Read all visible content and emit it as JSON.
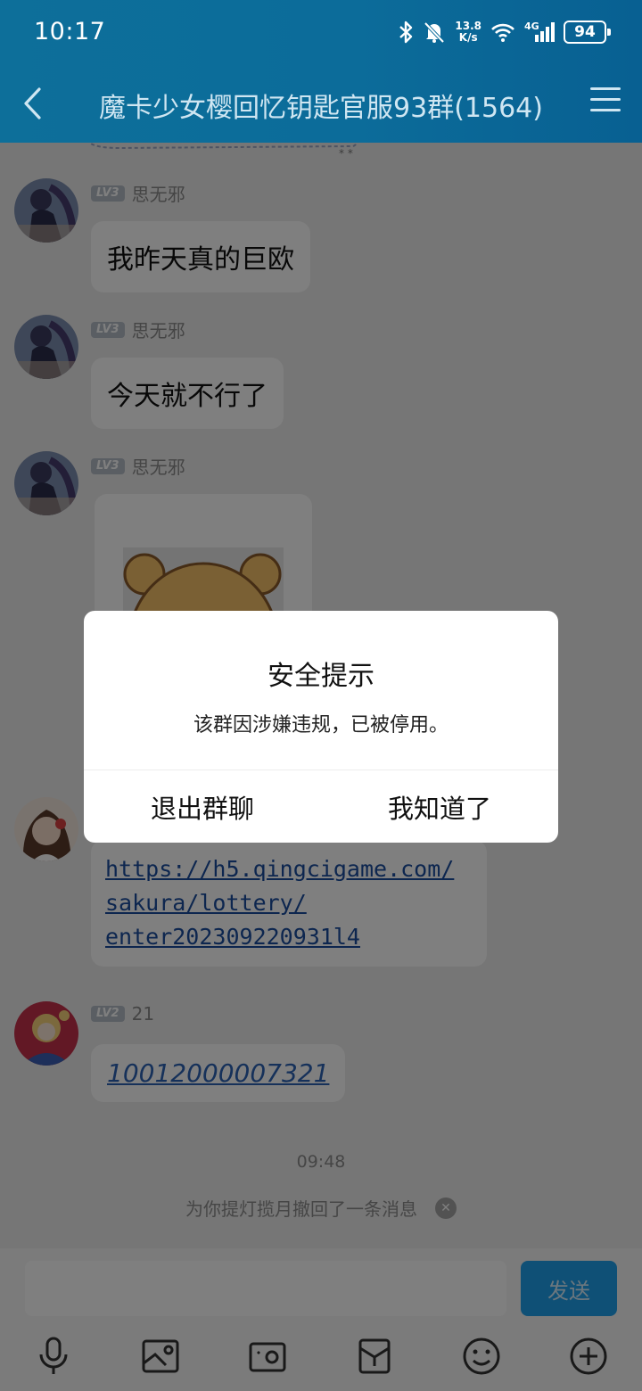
{
  "status_bar": {
    "time": "10:17",
    "net_speed_value": "13.8",
    "net_speed_unit": "K/s",
    "network_type": "4G",
    "battery": "94"
  },
  "nav": {
    "title": "魔卡少女樱回忆钥匙官服93群(1564)"
  },
  "messages": [
    {
      "level": "LV3",
      "nickname": "思无邪",
      "text": "我昨天真的巨欧"
    },
    {
      "level": "LV3",
      "nickname": "思无邪",
      "text": "今天就不行了"
    },
    {
      "level": "LV3",
      "nickname": "思无邪",
      "type": "sticker"
    },
    {
      "link_lines": [
        "https://h5.qingcigame.com/",
        "sakura/lottery/",
        "enter202309220931l4"
      ]
    },
    {
      "level": "LV2",
      "nickname": "21",
      "text": "10012000007321"
    }
  ],
  "timestamp": "09:48",
  "recall_notice": "为你提灯揽月撤回了一条消息",
  "input": {
    "placeholder": "",
    "send_label": "发送"
  },
  "toolbar_icons": [
    "microphone-icon",
    "photo-icon",
    "camera-icon",
    "red-packet-icon",
    "emoji-icon",
    "plus-icon"
  ],
  "dialog": {
    "title": "安全提示",
    "message": "该群因涉嫌违规，已被停用。",
    "exit_label": "退出群聊",
    "ok_label": "我知道了"
  },
  "colors": {
    "header": "#0c6c9a",
    "send_button": "#1ea0ec",
    "link": "#1a4d9e"
  }
}
